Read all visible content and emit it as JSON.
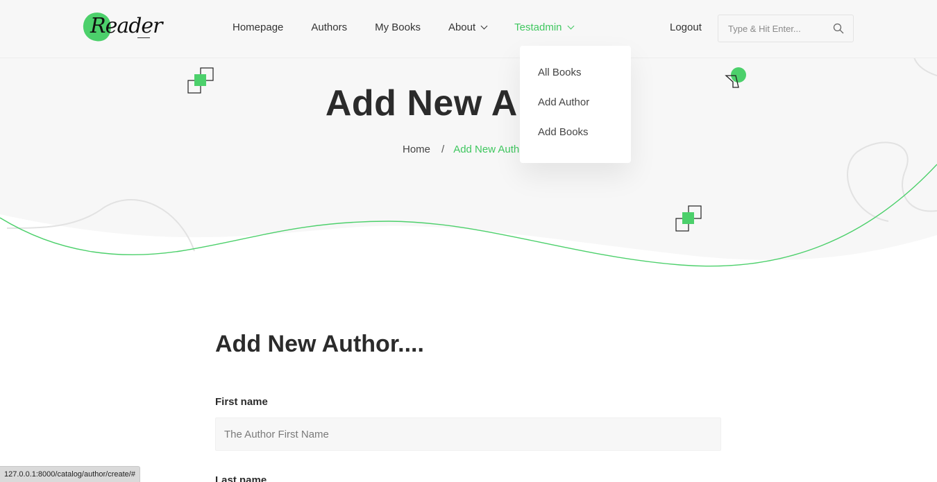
{
  "brand": {
    "logo_text": "Reader"
  },
  "nav": {
    "items": [
      {
        "label": "Homepage"
      },
      {
        "label": "Authors"
      },
      {
        "label": "My Books"
      },
      {
        "label": "About"
      },
      {
        "label": "Testadmin"
      }
    ],
    "logout_label": "Logout"
  },
  "search": {
    "placeholder": "Type & Hit Enter...",
    "icon": "search-icon"
  },
  "dropdown": {
    "items": [
      {
        "label": "All Books"
      },
      {
        "label": "Add Author"
      },
      {
        "label": "Add Books"
      }
    ]
  },
  "hero": {
    "title": "Add New Author",
    "breadcrumb": {
      "home": "Home",
      "separator": "/",
      "current": "Add New Author"
    }
  },
  "form": {
    "heading": "Add New Author....",
    "first_name": {
      "label": "First name",
      "placeholder": "The Author First Name"
    },
    "last_name": {
      "label": "Last name"
    }
  },
  "status_url": "127.0.0.1:8000/catalog/author/create/#",
  "colors": {
    "accent": "#4cd06b",
    "hero_bg": "#f7f7f7",
    "text": "#2b2b2b"
  }
}
